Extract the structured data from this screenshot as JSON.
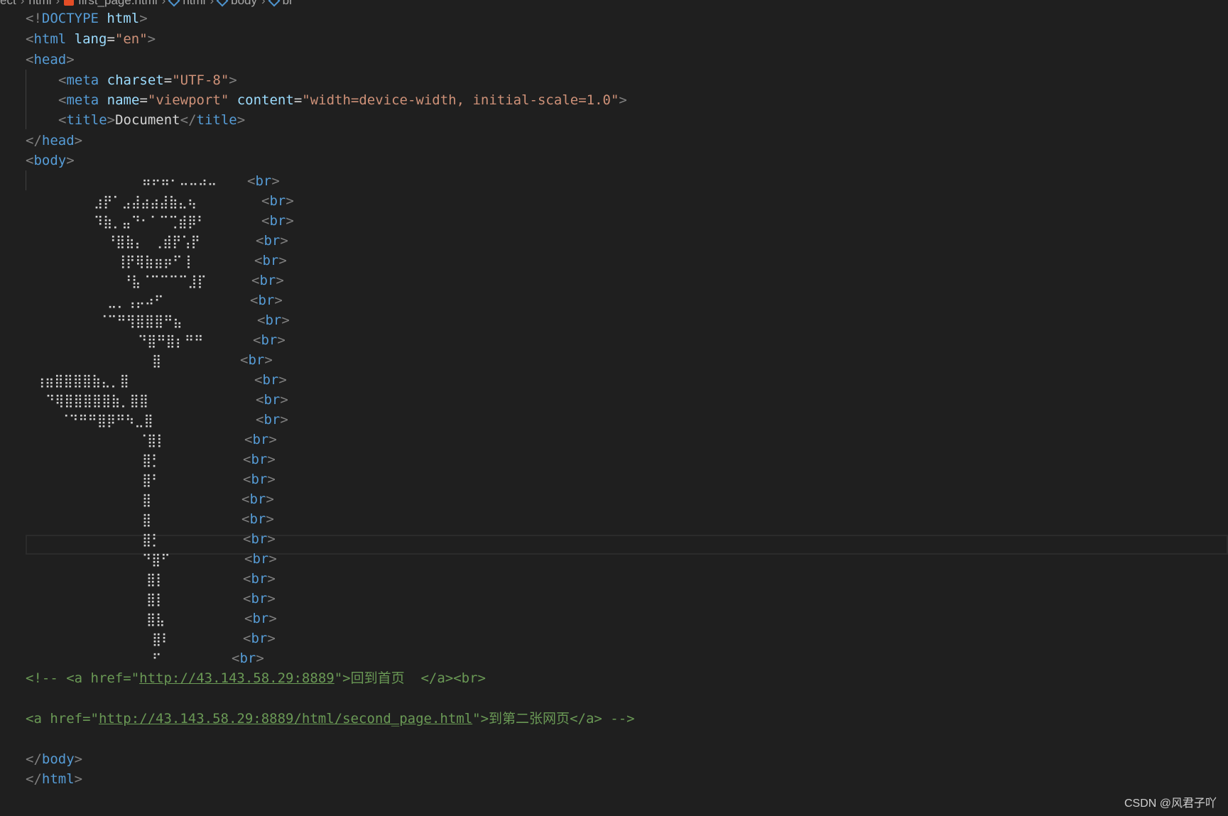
{
  "breadcrumb": {
    "items": [
      "ect",
      "html",
      "first_page.html",
      "html",
      "body",
      "br"
    ]
  },
  "code": {
    "doctype": {
      "open": "<!",
      "keyword": "DOCTYPE",
      "name": "html",
      "close": ">"
    },
    "html_open": {
      "tag": "html",
      "attr": "lang",
      "value": "\"en\""
    },
    "head_open": "head",
    "meta_charset": {
      "tag": "meta",
      "attr": "charset",
      "value": "\"UTF-8\""
    },
    "meta_viewport": {
      "tag": "meta",
      "attr1": "name",
      "value1": "\"viewport\"",
      "attr2": "content",
      "value2": "\"width=device-width, initial-scale=1.0\""
    },
    "title": {
      "tag": "title",
      "text": "Document"
    },
    "head_close": "head",
    "body_open": "body",
    "br_tag": "br",
    "ascii_art": [
      "  ⠶⠖⠶⠂⠤⠤⠴⠤",
      "⣰⡟⠁⣠⣼⣴⣴⣼⣷⣄⢦",
      "⠹⣷⡀⣤⠙⠂⠁⠉⢉⣾⡿⠃",
      "⠘⣿⣷⡄⠀⢀⣾⡟⢡⡟",
      "⢸⡟⢿⣷⣶⡶⠋⢸",
      "⠘⣧⠈⠉⠉⠉⠉⣸⡏",
      "⠀⣀⡀⢠⡤⠴⠋",
      "⠈⠉⠛⢻⣿⣿⣿⠛⣦",
      "⠙⣿⠛⣿⡆⠛⠛",
      "⣿",
      "⢰⣶⣿⣿⣿⣿⣷⣄⡀⣿",
      "⠙⢿⣿⣿⣿⣿⣿⣷⡀⣿⣿",
      "⠈⠙⠛⠛⣿⡿⠛⠳⣀⣿",
      "⠈⣿⡇",
      "⣿⡃",
      "⣿⠃",
      "⣿",
      "⣿",
      "⣿⡃",
      "⠙⣿⠋",
      "⣿⡇",
      "⣿⡇",
      "⣿⣧",
      "⣿⠇",
      "⠋"
    ],
    "comment_line1": {
      "open": "<!-- <a href=\"",
      "url": "http://43.143.58.29:8889",
      "mid": "\">",
      "cjk": "回到首页",
      "end": "  </a><br>"
    },
    "comment_line2": {
      "open": "<a href=\"",
      "url": "http://43.143.58.29:8889/html/second_page.html",
      "mid": "\">",
      "cjk": "到第二张网页",
      "end": "</a> -->"
    },
    "body_close": "body",
    "html_close": "html"
  },
  "watermark": "CSDN @风君子吖",
  "colors": {
    "background": "#1f1f1f",
    "tag": "#569cd6",
    "attribute": "#9cdcfe",
    "string": "#ce9178",
    "comment": "#6a9955",
    "punctuation": "#808080",
    "text": "#d4d4d4"
  }
}
